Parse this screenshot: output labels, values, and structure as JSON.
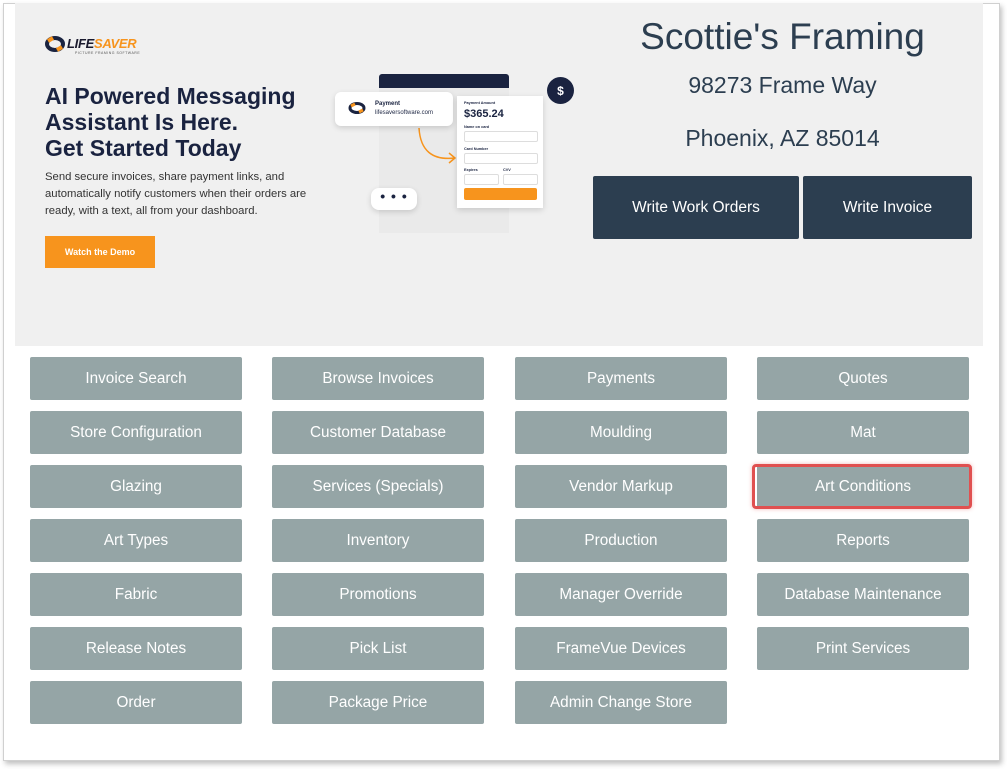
{
  "promo": {
    "logo_part1": "LIFE",
    "logo_part2": "SAVER",
    "logo_tagline": "PICTURE FRAMING SOFTWARE",
    "title_line1": "AI Powered Messaging",
    "title_line2": "Assistant Is Here.",
    "title_line3": "Get Started Today",
    "body": "Send secure invoices, share payment links, and automatically notify customers when their orders are ready, with a text, all from your dashboard.",
    "cta_label": "Watch the Demo",
    "mock": {
      "payment_label": "Payment",
      "payment_site": "lifesaversoftware.com",
      "amount_label": "Payment Amount",
      "amount": "$365.24",
      "name_label": "Name on card",
      "card_label": "Card Number",
      "expires_label": "Expires",
      "cvv_label": "CVV",
      "dollar": "$",
      "dots": "• • •"
    }
  },
  "store": {
    "name": "Scottie's Framing",
    "address_line1": "98273 Frame Way",
    "address_line2": "Phoenix, AZ 85014"
  },
  "actions": {
    "write_work_orders": "Write Work Orders",
    "write_invoice": "Write Invoice"
  },
  "menu": [
    [
      "Invoice Search",
      "Browse Invoices",
      "Payments",
      "Quotes"
    ],
    [
      "Store Configuration",
      "Customer Database",
      "Moulding",
      "Mat"
    ],
    [
      "Glazing",
      "Services (Specials)",
      "Vendor Markup",
      "Art Conditions"
    ],
    [
      "Art Types",
      "Inventory",
      "Production",
      "Reports"
    ],
    [
      "Fabric",
      "Promotions",
      "Manager Override",
      "Database Maintenance"
    ],
    [
      "Release Notes",
      "Pick List",
      "FrameVue Devices",
      "Print Services"
    ],
    [
      "Order",
      "Package Price",
      "Admin Change Store"
    ]
  ],
  "colors": {
    "dark_button": "#2c3e50",
    "grid_button": "#95a5a6",
    "highlight": "#e05050",
    "accent": "#f7941d"
  }
}
